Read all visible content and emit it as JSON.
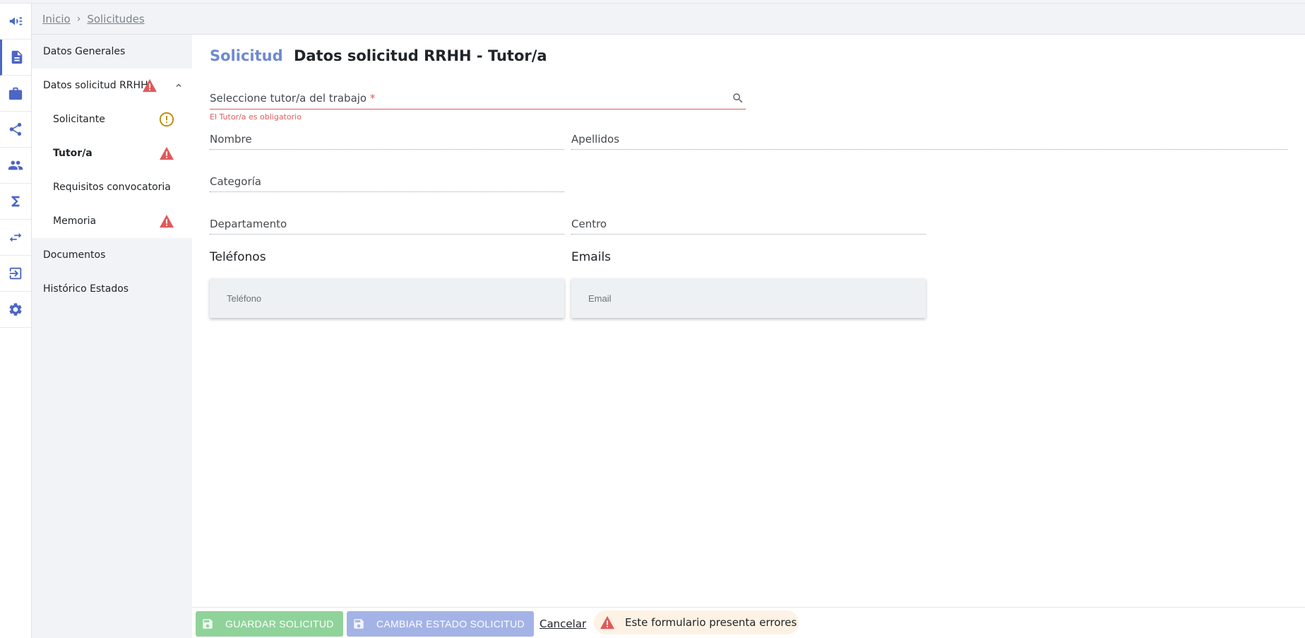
{
  "breadcrumb": {
    "home": "Inicio",
    "current": "Solicitudes",
    "separator": "›"
  },
  "rail": [
    {
      "icon": "megaphone-icon"
    },
    {
      "icon": "document-icon",
      "active": true
    },
    {
      "icon": "briefcase-icon"
    },
    {
      "icon": "share-icon"
    },
    {
      "icon": "people-icon"
    },
    {
      "icon": "sigma-icon"
    },
    {
      "icon": "swap-icon"
    },
    {
      "icon": "logout-icon"
    },
    {
      "icon": "gear-icon"
    }
  ],
  "nav": {
    "datos_generales": "Datos Generales",
    "datos_rrhh": "Datos solicitud RRHH",
    "solicitante": "Solicitante",
    "tutor": "Tutor/a",
    "requisitos": "Requisitos convocatoria",
    "memoria": "Memoria",
    "documentos": "Documentos",
    "historico": "Histórico Estados"
  },
  "page": {
    "title_prefix": "Solicitud",
    "title": "Datos solicitud RRHH - Tutor/a"
  },
  "form": {
    "tutor_label": "Seleccione tutor/a del trabajo",
    "tutor_required": "*",
    "tutor_error": "El Tutor/a es obligatorio",
    "nombre": "Nombre",
    "apellidos": "Apellidos",
    "categoria": "Categoría",
    "departamento": "Departamento",
    "centro": "Centro",
    "telefonos_title": "Teléfonos",
    "emails_title": "Emails",
    "telefono_placeholder": "Teléfono",
    "email_placeholder": "Email"
  },
  "actions": {
    "save": "GUARDAR SOLICITUD",
    "change_state": "CAMBIAR ESTADO SOLICITUD",
    "cancel": "Cancelar",
    "error_msg": "Este formulario presenta errores"
  },
  "colors": {
    "accent": "#4c66c4",
    "error": "#e05a5a",
    "warning": "#b88a00",
    "save_button": "#8fd39a",
    "state_button": "#a4b3e6"
  }
}
